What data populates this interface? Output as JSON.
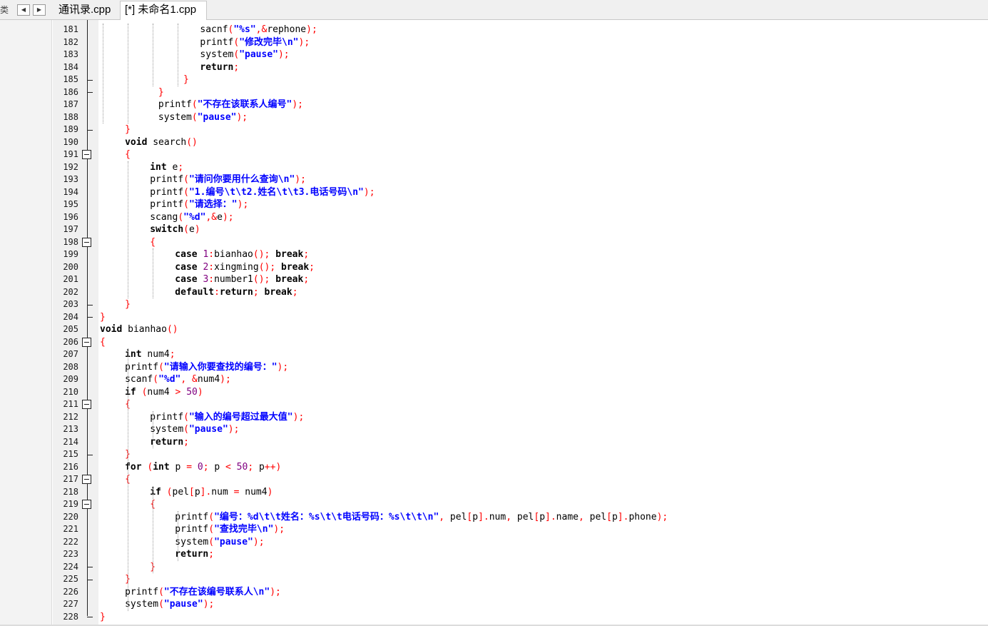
{
  "tabbar": {
    "left_fragment": "类",
    "tabs": [
      {
        "label": "通讯录.cpp",
        "active": false
      },
      {
        "label": "[*] 未命名1.cpp",
        "active": true
      }
    ],
    "nav_prev_icon": "triangle-left-icon",
    "nav_next_icon": "triangle-right-icon"
  },
  "editor": {
    "colors": {
      "keyword": "#000000",
      "string": "#0000ff",
      "number": "#800080",
      "symbol": "#ff0000"
    },
    "first_line_number": 181,
    "lines": [
      {
        "n": 181,
        "indent": 12,
        "tokens": [
          [
            "t",
            "sacnf"
          ],
          [
            "s",
            "("
          ],
          [
            "str",
            "\"%s\""
          ],
          [
            "s",
            ",&"
          ],
          [
            "t",
            "rephone"
          ],
          [
            "s",
            ");"
          ]
        ]
      },
      {
        "n": 182,
        "indent": 12,
        "tokens": [
          [
            "t",
            "printf"
          ],
          [
            "s",
            "("
          ],
          [
            "str",
            "\"修改完毕\\n\""
          ],
          [
            "s",
            ");"
          ]
        ]
      },
      {
        "n": 183,
        "indent": 12,
        "tokens": [
          [
            "t",
            "system"
          ],
          [
            "s",
            "("
          ],
          [
            "str",
            "\"pause\""
          ],
          [
            "s",
            ");"
          ]
        ]
      },
      {
        "n": 184,
        "indent": 12,
        "tokens": [
          [
            "kw",
            "return"
          ],
          [
            "s",
            ";"
          ]
        ]
      },
      {
        "n": 185,
        "indent": 10,
        "tokens": [
          [
            "s",
            "}"
          ]
        ]
      },
      {
        "n": 186,
        "indent": 7,
        "tokens": [
          [
            "s",
            "}"
          ]
        ]
      },
      {
        "n": 187,
        "indent": 7,
        "tokens": [
          [
            "t",
            "printf"
          ],
          [
            "s",
            "("
          ],
          [
            "str",
            "\"不存在该联系人编号\""
          ],
          [
            "s",
            ");"
          ]
        ]
      },
      {
        "n": 188,
        "indent": 7,
        "tokens": [
          [
            "t",
            "system"
          ],
          [
            "s",
            "("
          ],
          [
            "str",
            "\"pause\""
          ],
          [
            "s",
            ");"
          ]
        ]
      },
      {
        "n": 189,
        "indent": 3,
        "tokens": [
          [
            "s",
            "}"
          ]
        ]
      },
      {
        "n": 190,
        "indent": 3,
        "tokens": [
          [
            "kw",
            "void"
          ],
          [
            "t",
            " search"
          ],
          [
            "s",
            "()"
          ]
        ]
      },
      {
        "n": 191,
        "indent": 3,
        "tokens": [
          [
            "s",
            "{"
          ]
        ]
      },
      {
        "n": 192,
        "indent": 6,
        "tokens": [
          [
            "kw",
            "int"
          ],
          [
            "t",
            " e"
          ],
          [
            "s",
            ";"
          ]
        ]
      },
      {
        "n": 193,
        "indent": 6,
        "tokens": [
          [
            "t",
            "printf"
          ],
          [
            "s",
            "("
          ],
          [
            "str",
            "\"请问你要用什么查询\\n\""
          ],
          [
            "s",
            ");"
          ]
        ]
      },
      {
        "n": 194,
        "indent": 6,
        "tokens": [
          [
            "t",
            "printf"
          ],
          [
            "s",
            "("
          ],
          [
            "str",
            "\"1.编号\\t\\t2.姓名\\t\\t3.电话号码\\n\""
          ],
          [
            "s",
            ");"
          ]
        ]
      },
      {
        "n": 195,
        "indent": 6,
        "tokens": [
          [
            "t",
            "printf"
          ],
          [
            "s",
            "("
          ],
          [
            "str",
            "\"请选择：\""
          ],
          [
            "s",
            ");"
          ]
        ]
      },
      {
        "n": 196,
        "indent": 6,
        "tokens": [
          [
            "t",
            "scang"
          ],
          [
            "s",
            "("
          ],
          [
            "str",
            "\"%d\""
          ],
          [
            "s",
            ",&"
          ],
          [
            "t",
            "e"
          ],
          [
            "s",
            ");"
          ]
        ]
      },
      {
        "n": 197,
        "indent": 6,
        "tokens": [
          [
            "kw",
            "switch"
          ],
          [
            "s",
            "("
          ],
          [
            "t",
            "e"
          ],
          [
            "s",
            ")"
          ]
        ]
      },
      {
        "n": 198,
        "indent": 6,
        "tokens": [
          [
            "s",
            "{"
          ]
        ]
      },
      {
        "n": 199,
        "indent": 9,
        "tokens": [
          [
            "kw",
            "case"
          ],
          [
            "t",
            " "
          ],
          [
            "num",
            "1"
          ],
          [
            "s",
            ":"
          ],
          [
            "t",
            "bianhao"
          ],
          [
            "s",
            "();"
          ],
          [
            "t",
            " "
          ],
          [
            "kw",
            "break"
          ],
          [
            "s",
            ";"
          ]
        ]
      },
      {
        "n": 200,
        "indent": 9,
        "tokens": [
          [
            "kw",
            "case"
          ],
          [
            "t",
            " "
          ],
          [
            "num",
            "2"
          ],
          [
            "s",
            ":"
          ],
          [
            "t",
            "xingming"
          ],
          [
            "s",
            "();"
          ],
          [
            "t",
            " "
          ],
          [
            "kw",
            "break"
          ],
          [
            "s",
            ";"
          ]
        ]
      },
      {
        "n": 201,
        "indent": 9,
        "tokens": [
          [
            "kw",
            "case"
          ],
          [
            "t",
            " "
          ],
          [
            "num",
            "3"
          ],
          [
            "s",
            ":"
          ],
          [
            "t",
            "number1"
          ],
          [
            "s",
            "();"
          ],
          [
            "t",
            " "
          ],
          [
            "kw",
            "break"
          ],
          [
            "s",
            ";"
          ]
        ]
      },
      {
        "n": 202,
        "indent": 9,
        "tokens": [
          [
            "kw",
            "default"
          ],
          [
            "s",
            ":"
          ],
          [
            "kw",
            "return"
          ],
          [
            "s",
            ";"
          ],
          [
            "t",
            " "
          ],
          [
            "kw",
            "break"
          ],
          [
            "s",
            ";"
          ]
        ]
      },
      {
        "n": 203,
        "indent": 3,
        "tokens": [
          [
            "s",
            "}"
          ]
        ]
      },
      {
        "n": 204,
        "indent": 0,
        "tokens": [
          [
            "s",
            "}"
          ]
        ]
      },
      {
        "n": 205,
        "indent": 0,
        "tokens": [
          [
            "kw",
            "void"
          ],
          [
            "t",
            " bianhao"
          ],
          [
            "s",
            "()"
          ]
        ]
      },
      {
        "n": 206,
        "indent": 0,
        "tokens": [
          [
            "s",
            "{"
          ]
        ]
      },
      {
        "n": 207,
        "indent": 3,
        "tokens": [
          [
            "kw",
            "int"
          ],
          [
            "t",
            " num4"
          ],
          [
            "s",
            ";"
          ]
        ]
      },
      {
        "n": 208,
        "indent": 3,
        "tokens": [
          [
            "t",
            "printf"
          ],
          [
            "s",
            "("
          ],
          [
            "str",
            "\"请输入你要查找的编号：\""
          ],
          [
            "s",
            ");"
          ]
        ]
      },
      {
        "n": 209,
        "indent": 3,
        "tokens": [
          [
            "t",
            "scanf"
          ],
          [
            "s",
            "("
          ],
          [
            "str",
            "\"%d\""
          ],
          [
            "s",
            ", &"
          ],
          [
            "t",
            "num4"
          ],
          [
            "s",
            ");"
          ]
        ]
      },
      {
        "n": 210,
        "indent": 3,
        "tokens": [
          [
            "kw",
            "if"
          ],
          [
            "t",
            " "
          ],
          [
            "s",
            "("
          ],
          [
            "t",
            "num4 "
          ],
          [
            "s",
            ">"
          ],
          [
            "t",
            " "
          ],
          [
            "num",
            "50"
          ],
          [
            "s",
            ")"
          ]
        ]
      },
      {
        "n": 211,
        "indent": 3,
        "tokens": [
          [
            "s",
            "{"
          ]
        ]
      },
      {
        "n": 212,
        "indent": 6,
        "tokens": [
          [
            "t",
            "printf"
          ],
          [
            "s",
            "("
          ],
          [
            "str",
            "\"输入的编号超过最大值\""
          ],
          [
            "s",
            ");"
          ]
        ]
      },
      {
        "n": 213,
        "indent": 6,
        "tokens": [
          [
            "t",
            "system"
          ],
          [
            "s",
            "("
          ],
          [
            "str",
            "\"pause\""
          ],
          [
            "s",
            ");"
          ]
        ]
      },
      {
        "n": 214,
        "indent": 6,
        "tokens": [
          [
            "kw",
            "return"
          ],
          [
            "s",
            ";"
          ]
        ]
      },
      {
        "n": 215,
        "indent": 3,
        "tokens": [
          [
            "s",
            "}"
          ]
        ]
      },
      {
        "n": 216,
        "indent": 3,
        "tokens": [
          [
            "kw",
            "for"
          ],
          [
            "t",
            " "
          ],
          [
            "s",
            "("
          ],
          [
            "kw",
            "int"
          ],
          [
            "t",
            " p "
          ],
          [
            "s",
            "="
          ],
          [
            "t",
            " "
          ],
          [
            "num",
            "0"
          ],
          [
            "s",
            ";"
          ],
          [
            "t",
            " p "
          ],
          [
            "s",
            "<"
          ],
          [
            "t",
            " "
          ],
          [
            "num",
            "50"
          ],
          [
            "s",
            ";"
          ],
          [
            "t",
            " p"
          ],
          [
            "s",
            "++)"
          ]
        ]
      },
      {
        "n": 217,
        "indent": 3,
        "tokens": [
          [
            "s",
            "{"
          ]
        ]
      },
      {
        "n": 218,
        "indent": 6,
        "tokens": [
          [
            "kw",
            "if"
          ],
          [
            "t",
            " "
          ],
          [
            "s",
            "("
          ],
          [
            "t",
            "pel"
          ],
          [
            "s",
            "["
          ],
          [
            "t",
            "p"
          ],
          [
            "s",
            "]."
          ],
          [
            "t",
            "num "
          ],
          [
            "s",
            "="
          ],
          [
            "t",
            " num4"
          ],
          [
            "s",
            ")"
          ]
        ]
      },
      {
        "n": 219,
        "indent": 6,
        "tokens": [
          [
            "s",
            "{"
          ]
        ]
      },
      {
        "n": 220,
        "indent": 9,
        "tokens": [
          [
            "t",
            "printf"
          ],
          [
            "s",
            "("
          ],
          [
            "str",
            "\"编号：%d\\t\\t姓名：%s\\t\\t电话号码：%s\\t\\t\\n\""
          ],
          [
            "s",
            ","
          ],
          [
            "t",
            " pel"
          ],
          [
            "s",
            "["
          ],
          [
            "t",
            "p"
          ],
          [
            "s",
            "]."
          ],
          [
            "t",
            "num"
          ],
          [
            "s",
            ","
          ],
          [
            "t",
            " pel"
          ],
          [
            "s",
            "["
          ],
          [
            "t",
            "p"
          ],
          [
            "s",
            "]."
          ],
          [
            "t",
            "name"
          ],
          [
            "s",
            ","
          ],
          [
            "t",
            " pel"
          ],
          [
            "s",
            "["
          ],
          [
            "t",
            "p"
          ],
          [
            "s",
            "]."
          ],
          [
            "t",
            "phone"
          ],
          [
            "s",
            ");"
          ]
        ]
      },
      {
        "n": 221,
        "indent": 9,
        "tokens": [
          [
            "t",
            "printf"
          ],
          [
            "s",
            "("
          ],
          [
            "str",
            "\"查找完毕\\n\""
          ],
          [
            "s",
            ");"
          ]
        ]
      },
      {
        "n": 222,
        "indent": 9,
        "tokens": [
          [
            "t",
            "system"
          ],
          [
            "s",
            "("
          ],
          [
            "str",
            "\"pause\""
          ],
          [
            "s",
            ");"
          ]
        ]
      },
      {
        "n": 223,
        "indent": 9,
        "tokens": [
          [
            "kw",
            "return"
          ],
          [
            "s",
            ";"
          ]
        ]
      },
      {
        "n": 224,
        "indent": 6,
        "tokens": [
          [
            "s",
            "}"
          ]
        ]
      },
      {
        "n": 225,
        "indent": 3,
        "tokens": [
          [
            "s",
            "}"
          ]
        ]
      },
      {
        "n": 226,
        "indent": 3,
        "tokens": [
          [
            "t",
            "printf"
          ],
          [
            "s",
            "("
          ],
          [
            "str",
            "\"不存在该编号联系人\\n\""
          ],
          [
            "s",
            ");"
          ]
        ]
      },
      {
        "n": 227,
        "indent": 3,
        "tokens": [
          [
            "t",
            "system"
          ],
          [
            "s",
            "("
          ],
          [
            "str",
            "\"pause\""
          ],
          [
            "s",
            ");"
          ]
        ]
      },
      {
        "n": 228,
        "indent": 0,
        "tokens": [
          [
            "s",
            "}"
          ]
        ]
      }
    ],
    "fold_boxes": [
      191,
      198,
      206,
      211,
      217,
      219
    ],
    "fold_ticks": [
      185,
      186,
      189,
      203,
      204,
      215,
      224,
      225,
      228
    ],
    "fold_icon": "fold-minus-icon"
  }
}
